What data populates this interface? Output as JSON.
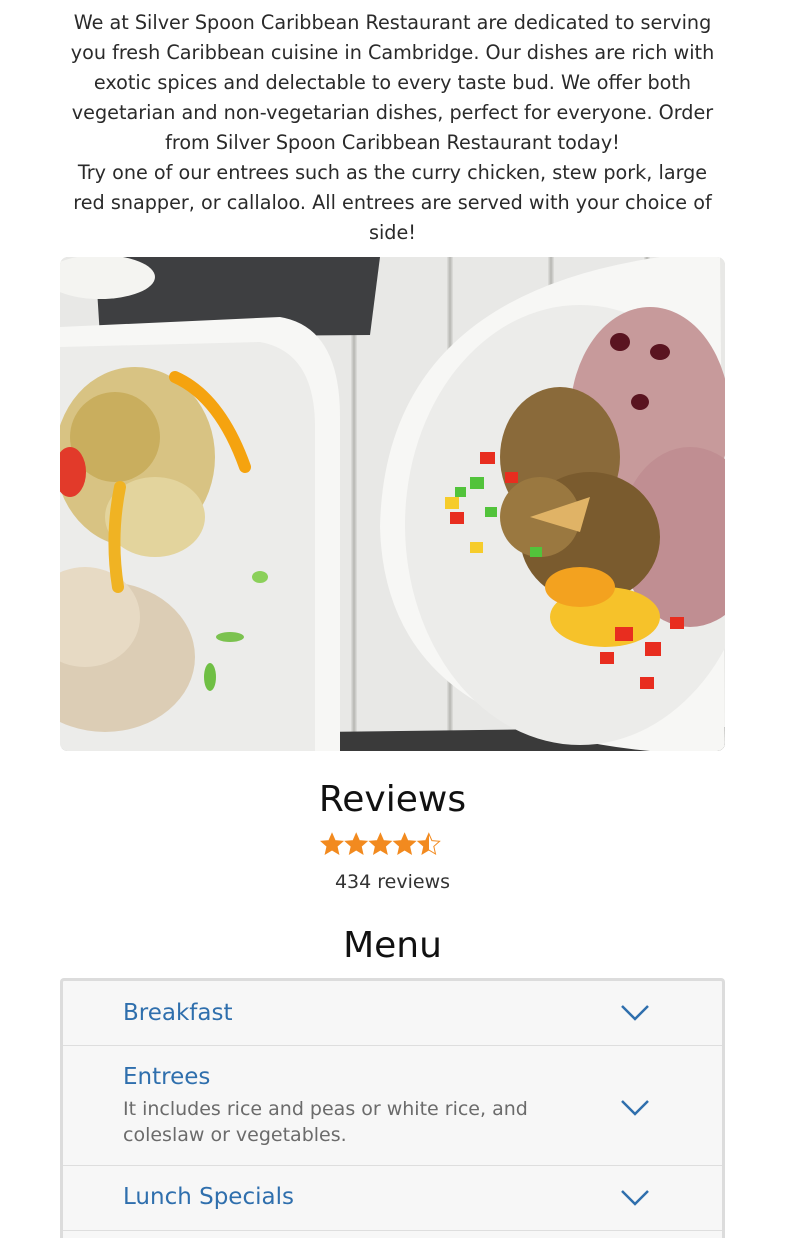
{
  "intro": {
    "paragraph1": "We at Silver Spoon Caribbean Restaurant are dedicated to serving you fresh Caribbean cuisine in Cambridge. Our dishes are rich with exotic spices and delectable to every taste bud. We offer both vegetarian and non-vegetarian dishes, perfect for everyone. Order from Silver Spoon Caribbean Restaurant today!",
    "paragraph2": "Try one of our entrees such as the curry chicken, stew pork, large red snapper, or callaloo. All entrees are served with your choice of side!"
  },
  "reviews": {
    "title": "Reviews",
    "rating": 4.5,
    "max_rating": 5,
    "count_label": "434 reviews"
  },
  "menu": {
    "title": "Menu",
    "sections": [
      {
        "name": "Breakfast",
        "description": ""
      },
      {
        "name": "Entrees",
        "description": "It includes rice and peas or white rice, and coleslaw or vegetables."
      },
      {
        "name": "Lunch Specials",
        "description": ""
      }
    ]
  },
  "colors": {
    "star": "#f28a1f",
    "star_empty": "#c8c8c8",
    "menu_link": "#2f6fad"
  },
  "icons": {
    "expand": "chevron-down-icon",
    "rating": "star-icon"
  }
}
